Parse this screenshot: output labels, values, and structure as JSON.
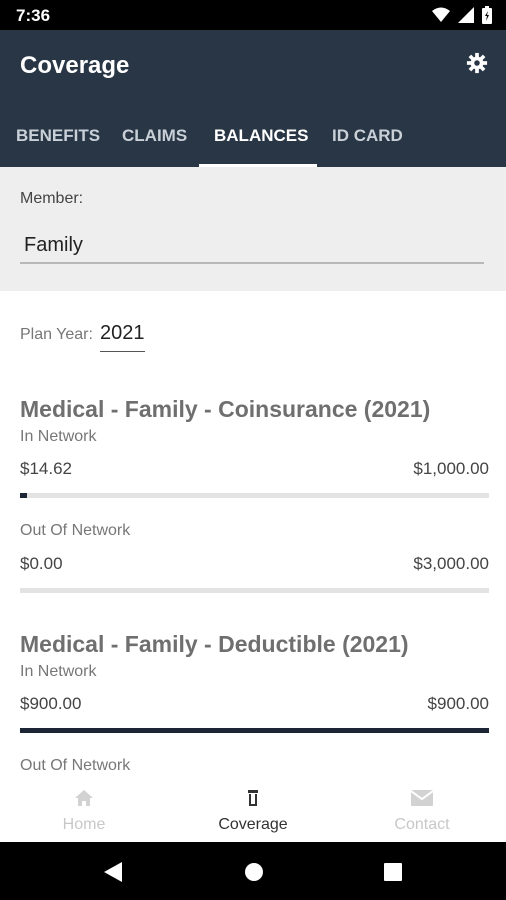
{
  "status_bar": {
    "time": "7:36"
  },
  "app_bar": {
    "title": "Coverage"
  },
  "tabs": [
    "BENEFITS",
    "CLAIMS",
    "BALANCES",
    "ID CARD"
  ],
  "active_tab": "BALANCES",
  "member": {
    "label": "Member:",
    "value": "Family"
  },
  "plan_year": {
    "label": "Plan Year:",
    "value": "2021"
  },
  "sections": [
    {
      "title": "Medical - Family - Coinsurance (2021)",
      "in_network": {
        "label": "In Network",
        "used": "$14.62",
        "max": "$1,000.00",
        "progress": 0.0146
      },
      "out_network": {
        "label": "Out Of Network",
        "used": "$0.00",
        "max": "$3,000.00",
        "progress": 0.0
      }
    },
    {
      "title": "Medical - Family - Deductible (2021)",
      "in_network": {
        "label": "In Network",
        "used": "$900.00",
        "max": "$900.00",
        "progress": 1.0
      },
      "out_network": {
        "label": "Out Of Network"
      }
    }
  ],
  "bottom_nav": [
    {
      "label": "Home",
      "icon": "home-icon",
      "active": false
    },
    {
      "label": "Coverage",
      "icon": "coverage-icon",
      "active": true
    },
    {
      "label": "Contact",
      "icon": "mail-icon",
      "active": false
    }
  ],
  "colors": {
    "appbar": "#283645",
    "progress_fill": "#1b2533",
    "progress_track": "#e3e3e3",
    "active_nav": "#333333",
    "inactive_nav": "#c8c8c8"
  }
}
